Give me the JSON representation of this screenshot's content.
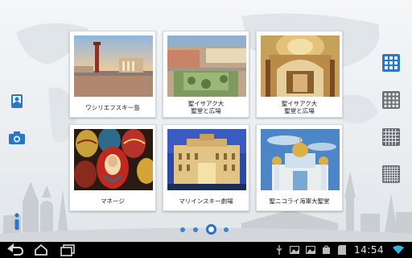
{
  "colors": {
    "accent_blue": "#2a77c9",
    "icon_gray": "#6b6f73",
    "dot_idle": "#3b82d4",
    "bar_bg": "#000000"
  },
  "left_tools": [
    {
      "icon": "photo-album-icon"
    },
    {
      "icon": "camera-icon"
    },
    {
      "icon": "info-icon"
    }
  ],
  "cards": [
    {
      "caption": "ワシリエフスキー島",
      "icon": "rostral-column-photo"
    },
    {
      "caption": "聖イサアク大\n聖堂と広場",
      "icon": "square-aerial-photo"
    },
    {
      "caption": "聖イサアク大\n聖堂と広場",
      "icon": "cathedral-interior-photo"
    },
    {
      "caption": "マネージ",
      "icon": "painted-eggs-photo"
    },
    {
      "caption": "マリインスキー劇場",
      "icon": "theatre-night-photo"
    },
    {
      "caption": "聖ニコライ海軍大聖堂",
      "icon": "naval-cathedral-photo"
    }
  ],
  "layout_options": [
    {
      "icon": "grid-2x2-icon",
      "active": true
    },
    {
      "icon": "grid-3x3-icon",
      "active": false
    },
    {
      "icon": "grid-4x4-icon",
      "active": false
    },
    {
      "icon": "grid-5x5-icon",
      "active": false
    }
  ],
  "pager": {
    "count": 4,
    "current": 3
  },
  "system_bar": {
    "time": "14:54",
    "nav": [
      "back-icon",
      "home-icon",
      "recent-apps-icon"
    ],
    "status": [
      "usb-icon",
      "image-icon",
      "image-icon",
      "bag-icon",
      "sd-card-icon"
    ]
  }
}
